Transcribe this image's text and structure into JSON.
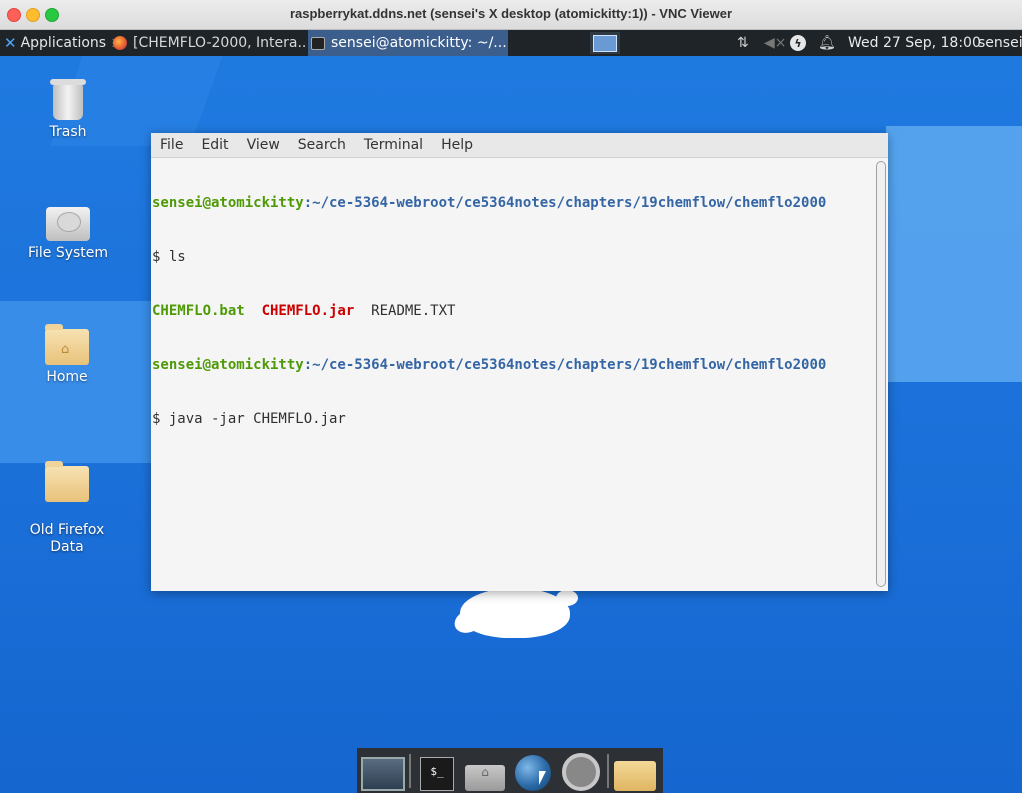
{
  "window": {
    "title": "raspberrykat.ddns.net (sensei's X desktop (atomickitty:1)) - VNC Viewer"
  },
  "panel": {
    "applications_label": "Applications",
    "tasks": [
      {
        "label": "[CHEMFLO-2000, Intera...",
        "icon": "firefox-icon"
      },
      {
        "label": "sensei@atomickitty: ~/...",
        "icon": "terminal-icon"
      }
    ],
    "clock": "Wed 27 Sep, 18:00",
    "user": "sensei"
  },
  "desktop_icons": [
    {
      "label": "Trash",
      "icon": "trash-icon"
    },
    {
      "label": "File System",
      "icon": "drive-icon"
    },
    {
      "label": "Home",
      "icon": "home-folder-icon"
    },
    {
      "label": "Old Firefox\nData",
      "icon": "folder-icon"
    }
  ],
  "terminal": {
    "menu": [
      "File",
      "Edit",
      "View",
      "Search",
      "Terminal",
      "Help"
    ],
    "user_host": "sensei@atomickitty",
    "path": ":~/ce-5364-webroot/ce5364notes/chapters/19chemflow/chemflo2000",
    "cmd1": "$ ls",
    "files": {
      "bat": "CHEMFLO.bat",
      "jar": "CHEMFLO.jar",
      "readme": "README.TXT"
    },
    "cmd2": "$ java -jar CHEMFLO.jar"
  },
  "dock": [
    "desktop-icon",
    "terminal-icon",
    "home-folder-icon",
    "web-browser-icon",
    "search-icon",
    "file-manager-icon"
  ]
}
